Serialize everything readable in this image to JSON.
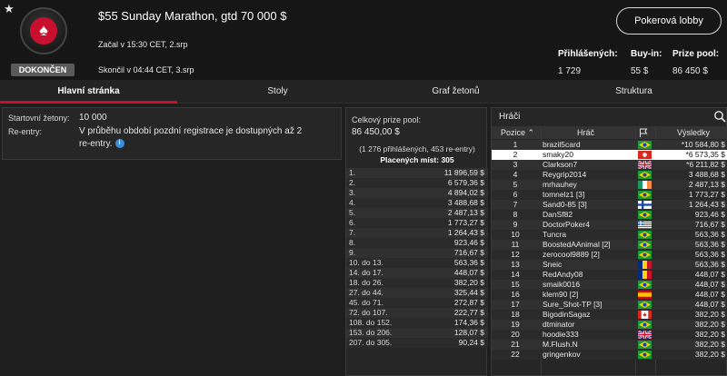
{
  "header": {
    "title": "$55 Sunday Marathon, gtd 70 000 $",
    "started": "Začal v 15:30 CET, 2.srp",
    "ended": "Skončil v 04:44 CET, 3.srp",
    "status": "DOKONČEN",
    "lobby_button": "Pokerová lobby",
    "stats": {
      "registered_label": "Přihlášených:",
      "registered_value": "1 729",
      "buyin_label": "Buy-in:",
      "buyin_value": "55 $",
      "prizepool_label": "Prize pool:",
      "prizepool_value": "86 450 $"
    }
  },
  "tabs": [
    "Hlavní stránka",
    "Stoly",
    "Graf žetonů",
    "Struktura"
  ],
  "info": {
    "chips_label": "Startovní žetony:",
    "chips_value": "10 000",
    "reentry_label": "Re-entry:",
    "reentry_line1": "V průběhu období pozdní registrace je dostupných až 2",
    "reentry_line2": "re-entry.",
    "info_icon": "i"
  },
  "prize": {
    "label": "Celkový prize pool:",
    "total": "86 450,00 $",
    "sub": "(1 276 přihlášených, 453 re-entry)",
    "paid": "Placených míst: 305",
    "rows": [
      {
        "place": "1.",
        "amount": "11 896,59 $"
      },
      {
        "place": "2.",
        "amount": "6 579,36 $"
      },
      {
        "place": "3.",
        "amount": "4 894,02 $"
      },
      {
        "place": "4.",
        "amount": "3 488,68 $"
      },
      {
        "place": "5.",
        "amount": "2 487,13 $"
      },
      {
        "place": "6.",
        "amount": "1 773,27 $"
      },
      {
        "place": "7.",
        "amount": "1 264,43 $"
      },
      {
        "place": "8.",
        "amount": "923,46 $"
      },
      {
        "place": "9.",
        "amount": "716,67 $"
      },
      {
        "place": "10. do 13.",
        "amount": "563,36 $"
      },
      {
        "place": "14. do 17.",
        "amount": "448,07 $"
      },
      {
        "place": "18. do 26.",
        "amount": "382,20 $"
      },
      {
        "place": "27. do 44.",
        "amount": "325,44 $"
      },
      {
        "place": "45. do 71.",
        "amount": "272,87 $"
      },
      {
        "place": "72. do 107.",
        "amount": "222,77 $"
      },
      {
        "place": "108. do 152.",
        "amount": "174,36 $"
      },
      {
        "place": "153. do 206.",
        "amount": "128,07 $"
      },
      {
        "place": "207. do 305.",
        "amount": "90,24 $"
      }
    ]
  },
  "players": {
    "title": "Hráči",
    "headers": {
      "pos": "Pozice",
      "player": "Hráč",
      "result": "Výsledky"
    },
    "rows": [
      {
        "pos": "1",
        "name": "brazil5card",
        "flag": "br",
        "result": "*10 584,80 $"
      },
      {
        "pos": "2",
        "name": "smaky20",
        "flag": "ch",
        "result": "*6 573,35 $"
      },
      {
        "pos": "3",
        "name": "Clarkson7",
        "flag": "gb",
        "result": "*6 211,82 $"
      },
      {
        "pos": "4",
        "name": "Reygrip2014",
        "flag": "br",
        "result": "3 488,68 $"
      },
      {
        "pos": "5",
        "name": "mrhauhey",
        "flag": "ie",
        "result": "2 487,13 $"
      },
      {
        "pos": "6",
        "name": "tomnelz1 [3]",
        "flag": "br",
        "result": "1 773,27 $"
      },
      {
        "pos": "7",
        "name": "Sand0-85 [3]",
        "flag": "fi",
        "result": "1 264,43 $"
      },
      {
        "pos": "8",
        "name": "DanSf82",
        "flag": "br",
        "result": "923,46 $"
      },
      {
        "pos": "9",
        "name": "DoctorPoker4",
        "flag": "gr",
        "result": "716,67 $"
      },
      {
        "pos": "10",
        "name": "Tuncra",
        "flag": "br",
        "result": "563,36 $"
      },
      {
        "pos": "11",
        "name": "BoostedAAnimal [2]",
        "flag": "br",
        "result": "563,36 $"
      },
      {
        "pos": "12",
        "name": "zerocool9889 [2]",
        "flag": "br",
        "result": "563,36 $"
      },
      {
        "pos": "13",
        "name": "Sneic",
        "flag": "ro",
        "result": "563,36 $"
      },
      {
        "pos": "14",
        "name": "RedAndy08",
        "flag": "ro",
        "result": "448,07 $"
      },
      {
        "pos": "15",
        "name": "smaik0016",
        "flag": "br",
        "result": "448,07 $"
      },
      {
        "pos": "16",
        "name": "klem90 [2]",
        "flag": "es",
        "result": "448,07 $"
      },
      {
        "pos": "17",
        "name": "Sure_Shot-TP [3]",
        "flag": "br",
        "result": "448,07 $"
      },
      {
        "pos": "18",
        "name": "BigodinSagaz",
        "flag": "ca",
        "result": "382,20 $"
      },
      {
        "pos": "19",
        "name": "dtminator",
        "flag": "br",
        "result": "382,20 $"
      },
      {
        "pos": "20",
        "name": "hoodie333",
        "flag": "gb",
        "result": "382,20 $"
      },
      {
        "pos": "21",
        "name": "M.Flush.N",
        "flag": "br",
        "result": "382,20 $"
      },
      {
        "pos": "22",
        "name": "gringenkov",
        "flag": "br",
        "result": "382,20 $"
      }
    ]
  },
  "colors": {
    "accent": "#c8102e",
    "background": "#1e1e1e",
    "panel": "#262626"
  }
}
